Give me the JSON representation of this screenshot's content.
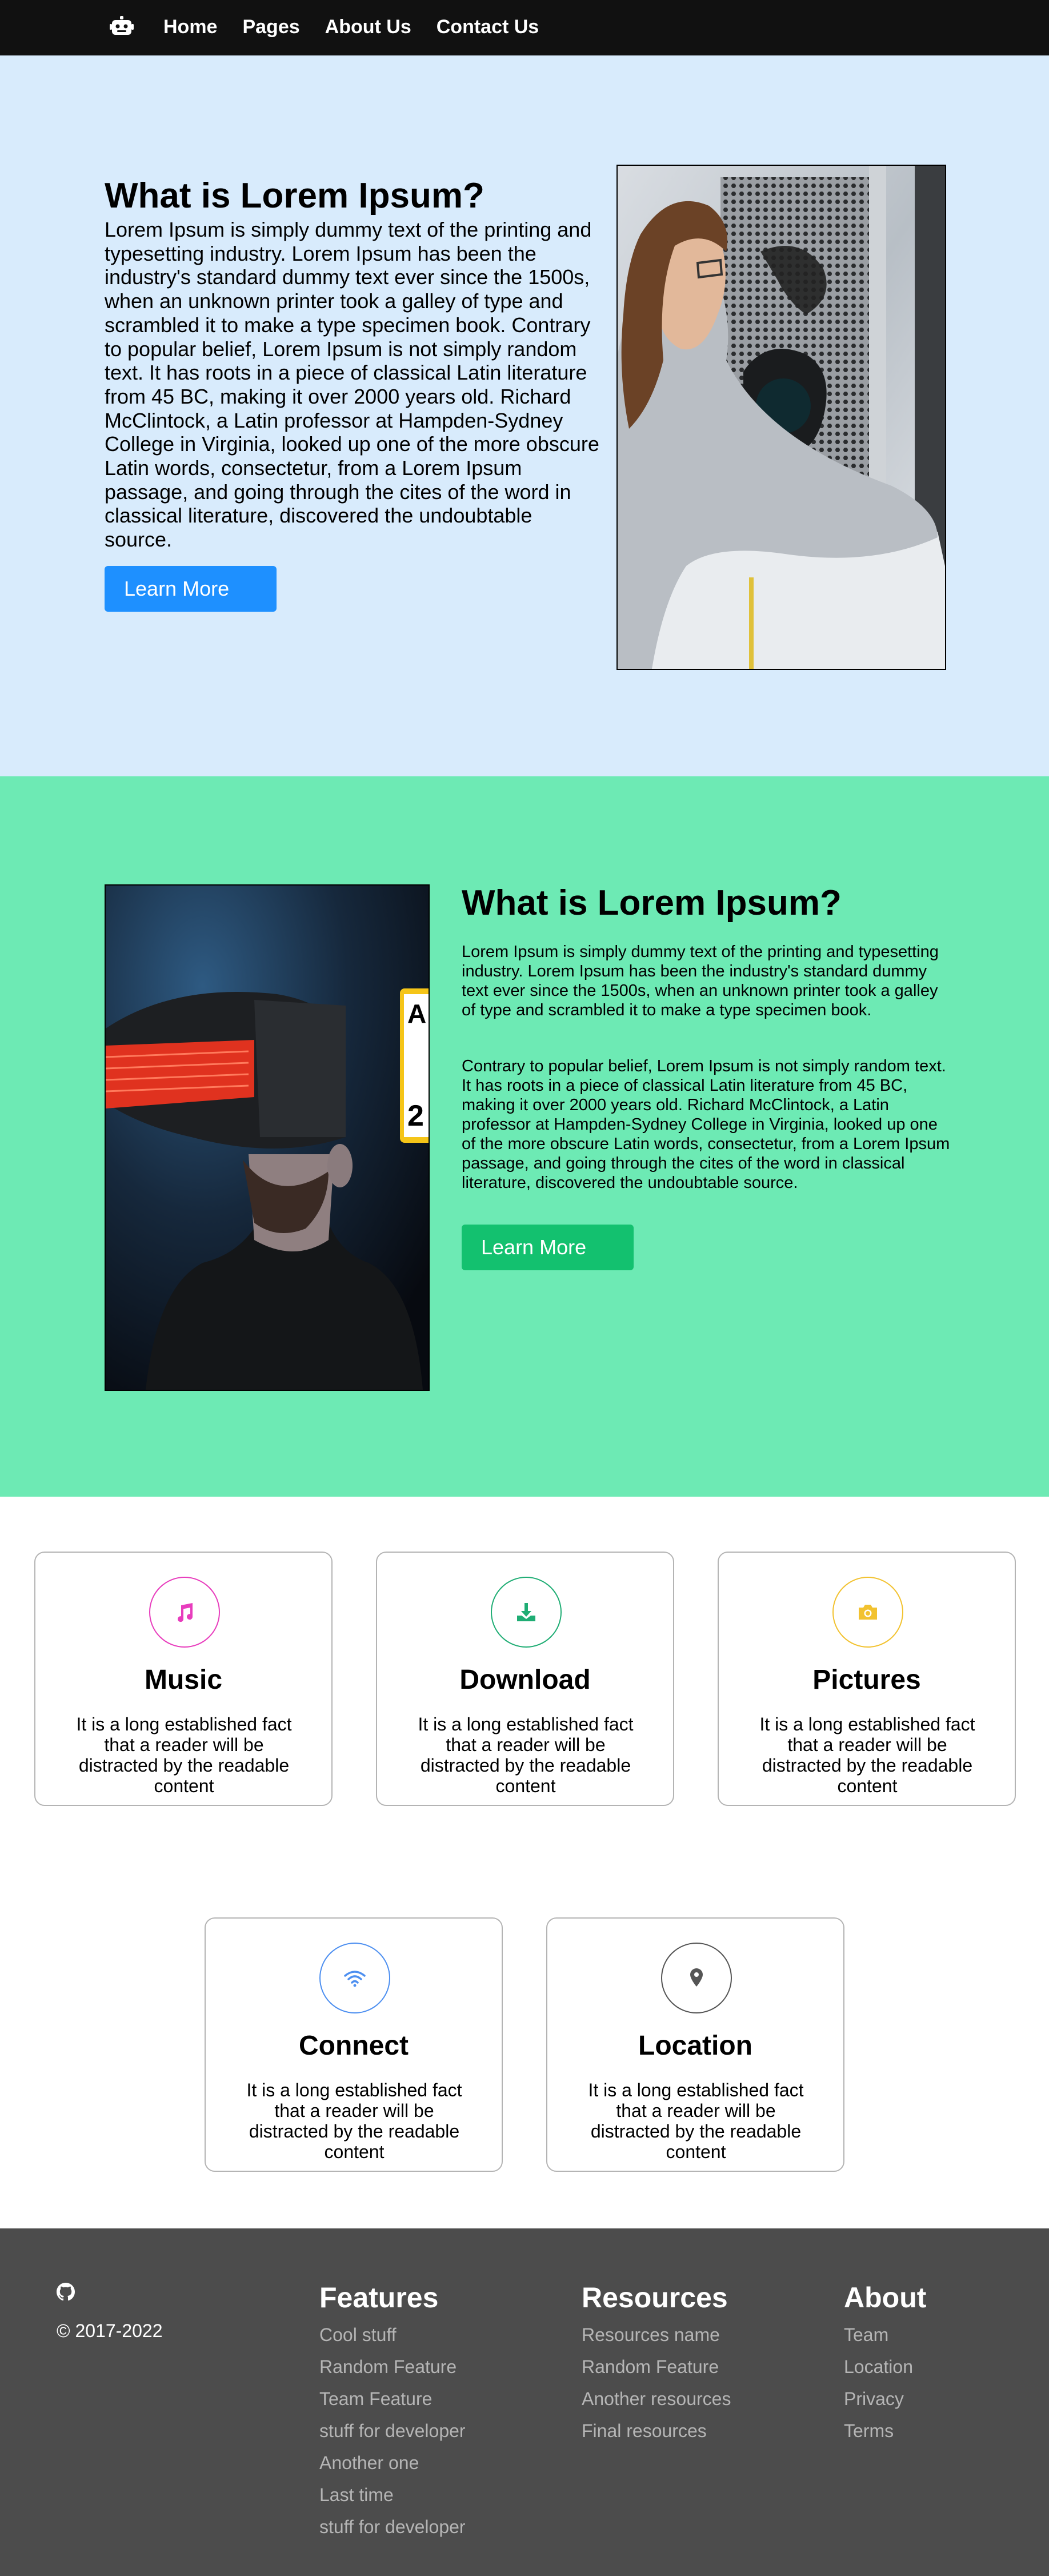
{
  "nav": {
    "logo_icon": "robot-icon",
    "links": [
      "Home",
      "Pages",
      "About Us",
      "Contact Us"
    ]
  },
  "hero1": {
    "title": "What is Lorem Ipsum?",
    "paragraph": "Lorem Ipsum is simply dummy text of the printing and typesetting industry. Lorem Ipsum has been the industry's standard dummy text ever since the 1500s, when an unknown printer took a galley of type and scrambled it to make a type specimen book. Contrary to popular belief, Lorem Ipsum is not simply random text. It has roots in a piece of classical Latin literature from 45 BC, making it over 2000 years old. Richard McClintock, a Latin professor at Hampden-Sydney College in Virginia, looked up one of the more obscure Latin words, consectetur, from a Lorem Ipsum passage, and going through the cites of the word in classical literature, discovered the undoubtable source.",
    "button": "Learn More",
    "background": "#d8ebfc",
    "button_color": "#1e90ff"
  },
  "hero2": {
    "title": "What is Lorem Ipsum?",
    "paragraph1": "Lorem Ipsum is simply dummy text of the printing and typesetting industry. Lorem Ipsum has been the industry's standard dummy text ever since the 1500s, when an unknown printer took a galley of type and scrambled it to make a type specimen book.",
    "paragraph2": "Contrary to popular belief, Lorem Ipsum is not simply random text. It has roots in a piece of classical Latin literature from 45 BC, making it over 2000 years old. Richard McClintock, a Latin professor at Hampden-Sydney College in Virginia, looked up one of the more obscure Latin words, consectetur, from a Lorem Ipsum passage, and going through the cites of the word in classical literature, discovered the undoubtable source.",
    "button": "Learn More",
    "background": "#6deab4",
    "button_color": "#13c16f"
  },
  "features": [
    {
      "title": "Music",
      "icon": "music-note-icon",
      "color": "#e83dbd",
      "text": "It is a long established fact that a reader will be distracted by the readable content"
    },
    {
      "title": "Download",
      "icon": "download-icon",
      "color": "#1fad74",
      "text": "It is a long established fact that a reader will be distracted by the readable content"
    },
    {
      "title": "Pictures",
      "icon": "camera-icon",
      "color": "#f2c230",
      "text": "It is a long established fact that a reader will be distracted by the readable content"
    },
    {
      "title": "Connect",
      "icon": "wifi-icon",
      "color": "#4d8ff0",
      "text": "It is a long established fact that a reader will be distracted by the readable content"
    },
    {
      "title": "Location",
      "icon": "location-pin-icon",
      "color": "#555555",
      "text": "It is a long established fact that a reader will be distracted by the readable content"
    }
  ],
  "footer": {
    "github_icon": "github-icon",
    "copyright": "© 2017-2022",
    "columns": [
      {
        "title": "Features",
        "links": [
          "Cool stuff",
          "Random Feature",
          "Team Feature",
          "stuff for developer",
          "Another one",
          "Last time",
          "stuff for developer"
        ]
      },
      {
        "title": "Resources",
        "links": [
          "Resources name",
          "Random Feature",
          "Another resources",
          "Final resources"
        ]
      },
      {
        "title": "About",
        "links": [
          "Team",
          "Location",
          "Privacy",
          "Terms"
        ]
      }
    ]
  }
}
